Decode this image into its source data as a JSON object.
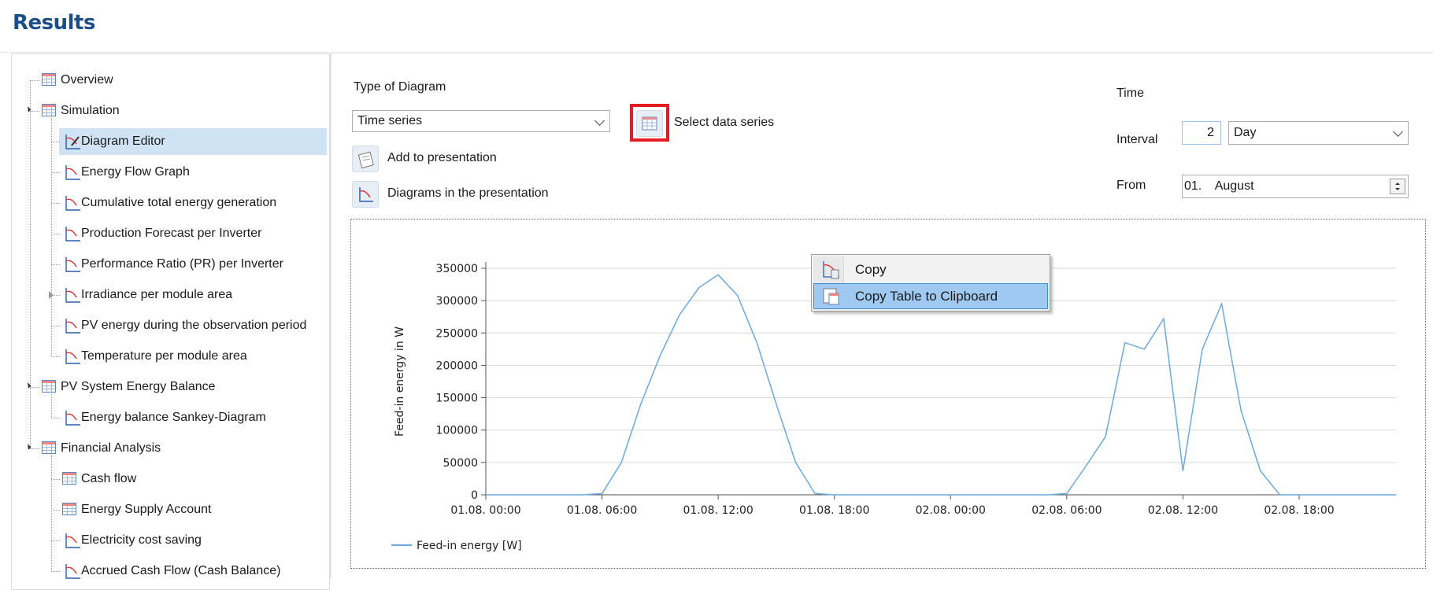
{
  "page": {
    "title": "Results"
  },
  "tree": {
    "items": [
      {
        "label": "Overview",
        "icon": "table-icon",
        "level": 0,
        "expander": "none"
      },
      {
        "label": "Simulation",
        "icon": "table-icon",
        "level": 0,
        "expander": "open"
      },
      {
        "label": "Diagram Editor",
        "icon": "diagram-editor-icon",
        "level": 1,
        "expander": "none",
        "selected": true
      },
      {
        "label": "Energy Flow Graph",
        "icon": "graph-icon",
        "level": 1,
        "expander": "none"
      },
      {
        "label": "Cumulative total energy generation",
        "icon": "graph-icon",
        "level": 1,
        "expander": "none"
      },
      {
        "label": "Production Forecast per Inverter",
        "icon": "graph-icon",
        "level": 1,
        "expander": "none"
      },
      {
        "label": "Performance Ratio (PR) per Inverter",
        "icon": "graph-icon",
        "level": 1,
        "expander": "none"
      },
      {
        "label": "Irradiance per module area",
        "icon": "graph-icon",
        "level": 1,
        "expander": "closed"
      },
      {
        "label": "PV energy during the observation period",
        "icon": "graph-icon",
        "level": 1,
        "expander": "none"
      },
      {
        "label": "Temperature per module area",
        "icon": "graph-icon",
        "level": 1,
        "expander": "none"
      },
      {
        "label": "PV System Energy Balance",
        "icon": "table-icon",
        "level": 0,
        "expander": "open"
      },
      {
        "label": "Energy balance Sankey-Diagram",
        "icon": "graph-icon",
        "level": 1,
        "expander": "none"
      },
      {
        "label": "Financial Analysis",
        "icon": "table-icon",
        "level": 0,
        "expander": "open"
      },
      {
        "label": "Cash flow",
        "icon": "table-icon",
        "level": 1,
        "expander": "none"
      },
      {
        "label": "Energy Supply Account",
        "icon": "table-icon",
        "level": 1,
        "expander": "none"
      },
      {
        "label": "Electricity cost saving",
        "icon": "graph-icon",
        "level": 1,
        "expander": "none"
      },
      {
        "label": "Accrued Cash Flow (Cash Balance)",
        "icon": "graph-icon",
        "level": 1,
        "expander": "none"
      }
    ]
  },
  "controls": {
    "type_of_diagram_label": "Type of Diagram",
    "type_of_diagram_value": "Time series",
    "select_series_label": "Select data series",
    "add_presentation_label": "Add to presentation",
    "diagrams_presentation_label": "Diagrams in the presentation",
    "time_label": "Time",
    "interval_label": "Interval",
    "interval_value": "2",
    "interval_unit": "Day",
    "from_label": "From",
    "from_day": "01.",
    "from_month": "August"
  },
  "context_menu": {
    "items": [
      {
        "label": "Copy",
        "active": false
      },
      {
        "label": "Copy Table to Clipboard",
        "active": true
      }
    ]
  },
  "chart_data": {
    "type": "line",
    "ylabel": "Feed-in energy  in W",
    "ylim": [
      0,
      350000
    ],
    "yticks": [
      0,
      50000,
      100000,
      150000,
      200000,
      250000,
      300000,
      350000
    ],
    "xticks": [
      "01.08. 00:00",
      "01.08. 06:00",
      "01.08. 12:00",
      "01.08. 18:00",
      "02.08. 00:00",
      "02.08. 06:00",
      "02.08. 12:00",
      "02.08. 18:00"
    ],
    "xlim_hours": [
      0,
      47
    ],
    "grid": true,
    "legend_position": "bottom-left",
    "color": "#6aa9e0",
    "series": [
      {
        "name": "Feed-in energy  [W]",
        "x": [
          0,
          5,
          6,
          7,
          8,
          9,
          10,
          11,
          12,
          13,
          14,
          15,
          16,
          17,
          18,
          24,
          29,
          30,
          31,
          32,
          33,
          34,
          35,
          36,
          37,
          38,
          39,
          40,
          41,
          42,
          47
        ],
        "y": [
          0,
          0,
          2000,
          50000,
          140000,
          215000,
          278000,
          320000,
          340000,
          308000,
          235000,
          140000,
          50000,
          2000,
          0,
          0,
          0,
          2000,
          45000,
          90000,
          235000,
          225000,
          272000,
          37000,
          225000,
          295000,
          130000,
          37000,
          0,
          0,
          0
        ]
      }
    ]
  }
}
